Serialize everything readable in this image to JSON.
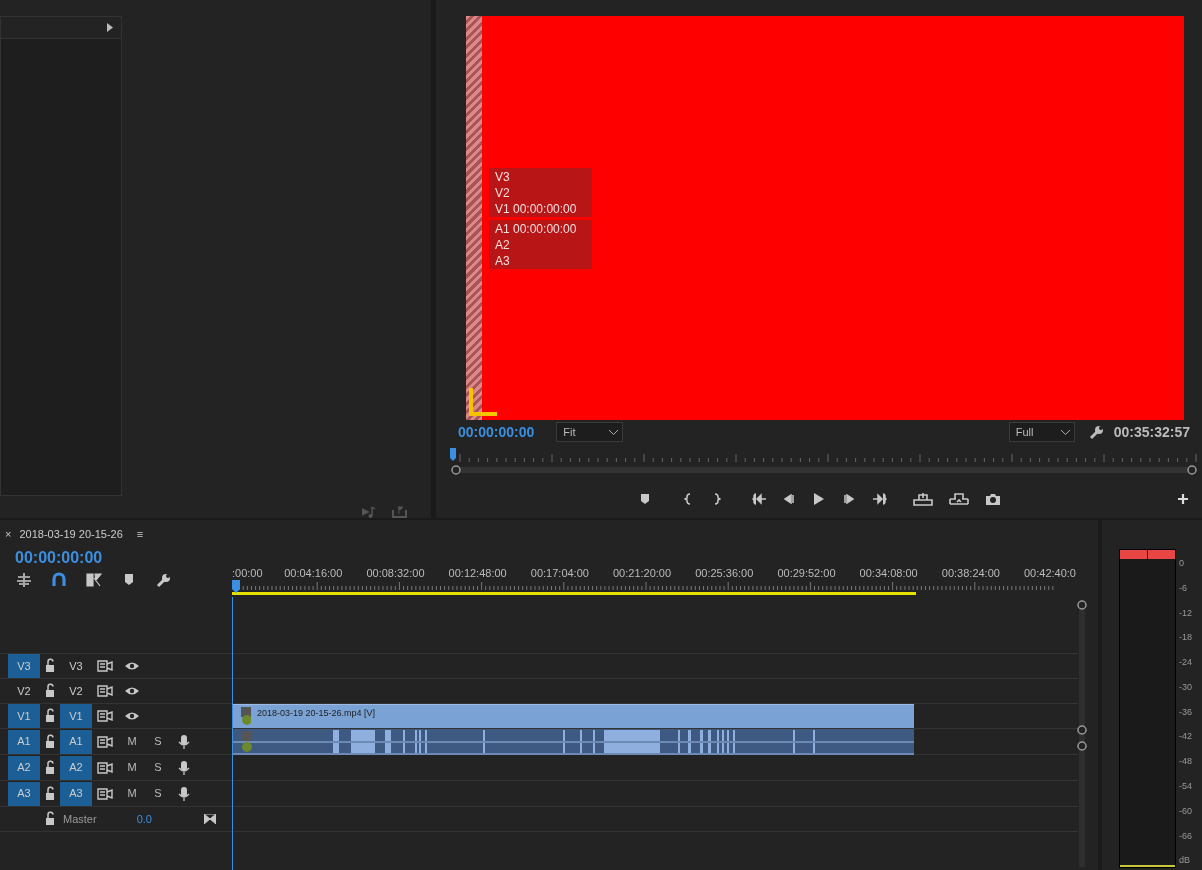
{
  "program_monitor": {
    "overlay_video_lines": [
      "V3",
      "V2",
      "V1 00:00:00:00"
    ],
    "overlay_audio_lines": [
      "A1 00:00:00:00",
      "A2",
      "A3"
    ],
    "playhead_timecode": "00:00:00:00",
    "zoom_select": "Fit",
    "resolution_select": "Full",
    "duration": "00:35:32:57"
  },
  "timeline": {
    "title": "2018-03-19 20-15-26",
    "close": "×",
    "menu": "≡",
    "timecode": "00:00:00:00",
    "ruler_labels": [
      ":00:00",
      "00:04:16:00",
      "00:08:32:00",
      "00:12:48:00",
      "00:17:04:00",
      "00:21:20:00",
      "00:25:36:00",
      "00:29:52:00",
      "00:34:08:00",
      "00:38:24:00",
      "00:42:40:0"
    ],
    "tracks": [
      {
        "kind": "video",
        "source_label": "V3",
        "source_patched": true,
        "target_label": "V3",
        "targeted": false
      },
      {
        "kind": "video",
        "source_label": "V2",
        "source_patched": false,
        "target_label": "V2",
        "targeted": false
      },
      {
        "kind": "video",
        "source_label": "V1",
        "source_patched": true,
        "target_label": "V1",
        "targeted": true,
        "clip": "2018-03-19 20-15-26.mp4 [V]"
      },
      {
        "kind": "audio",
        "source_label": "A1",
        "source_patched": true,
        "target_label": "A1",
        "targeted": true,
        "mute": "M",
        "solo": "S",
        "audio_clip": true
      },
      {
        "kind": "audio",
        "source_label": "A2",
        "source_patched": true,
        "target_label": "A2",
        "targeted": true,
        "mute": "M",
        "solo": "S"
      },
      {
        "kind": "audio",
        "source_label": "A3",
        "source_patched": true,
        "target_label": "A3",
        "targeted": true,
        "mute": "M",
        "solo": "S"
      }
    ],
    "master": {
      "label": "Master",
      "value": "0.0"
    }
  },
  "audio_meter": {
    "scale": [
      "0",
      "-6",
      "-12",
      "-18",
      "-24",
      "-30",
      "-36",
      "-42",
      "-48",
      "-54",
      "-60",
      "-66",
      "dB"
    ]
  }
}
